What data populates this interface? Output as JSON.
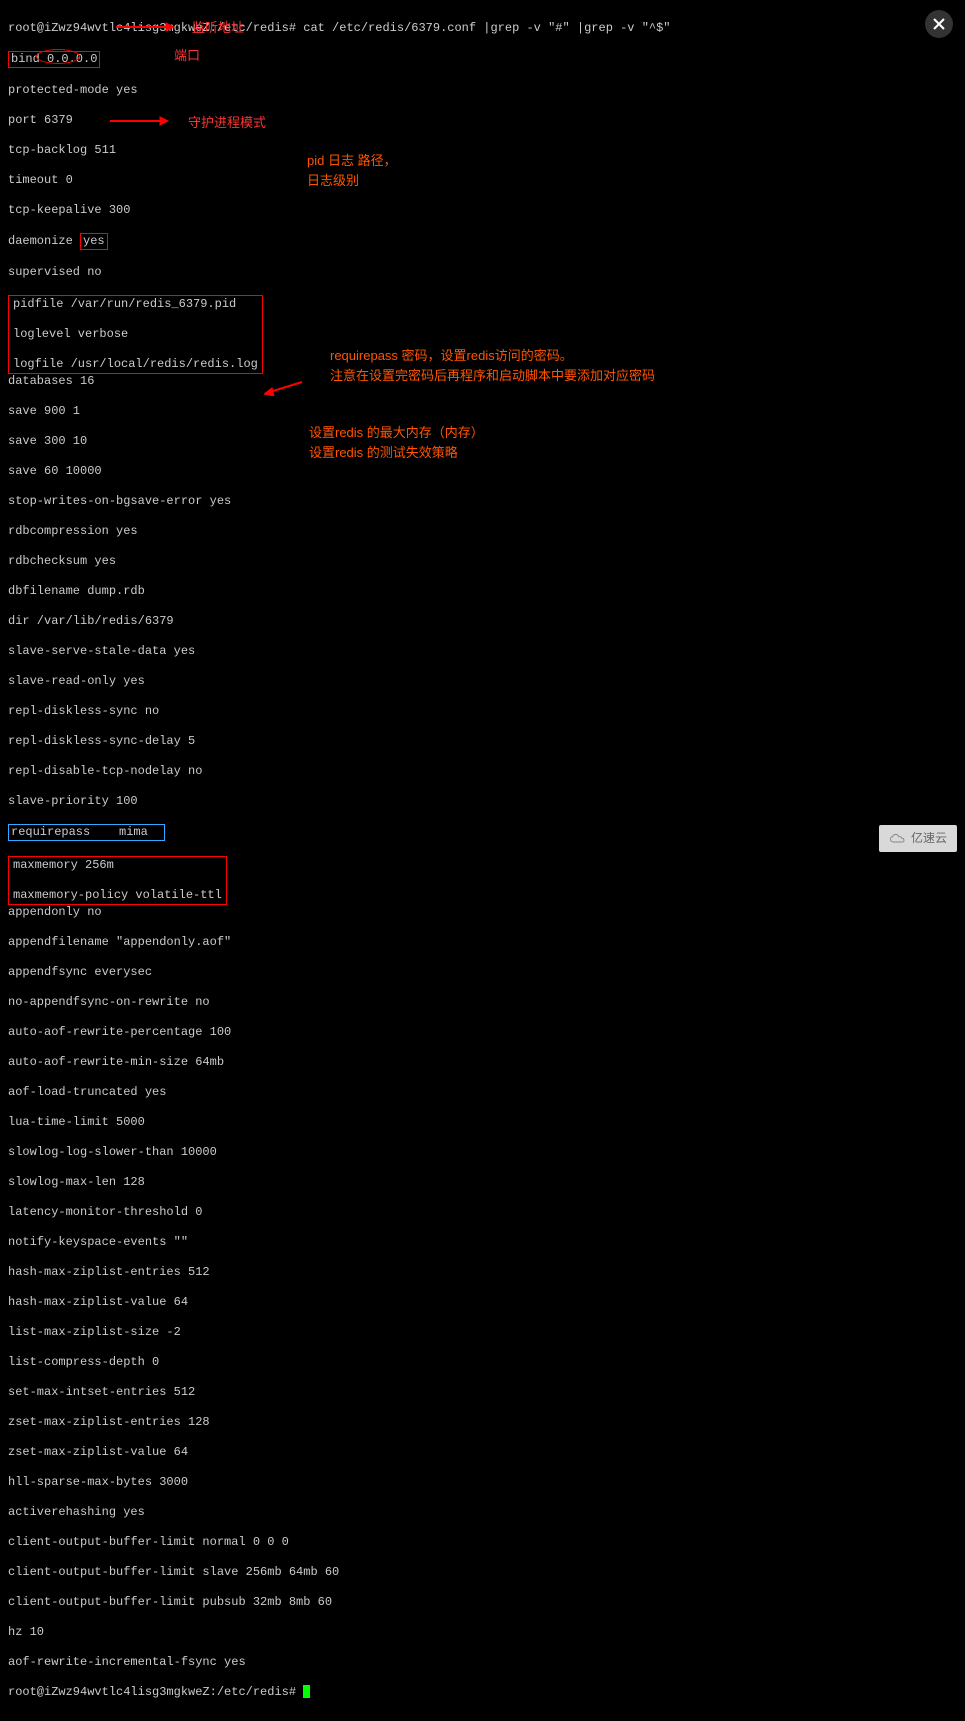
{
  "prompt_line": "root@iZwz94wvtlc4lisg3mgkweZ:/etc/redis# cat /etc/redis/6379.conf |grep -v \"#\" |grep -v \"^$\"",
  "prompt_end": "root@iZwz94wvtlc4lisg3mgkweZ:/etc/redis# ",
  "config": {
    "bind": "bind 0.0.0.0",
    "protected_mode": "protected-mode yes",
    "port": "port 6379",
    "tcp_backlog": "tcp-backlog 511",
    "timeout": "timeout 0",
    "tcp_keepalive": "tcp-keepalive 300",
    "daemonize_pre": "daemonize ",
    "daemonize_val": "yes",
    "supervised": "supervised no",
    "pidfile": "pidfile /var/run/redis_6379.pid",
    "loglevel": "loglevel verbose",
    "logfile": "logfile /usr/local/redis/redis.log",
    "databases": "databases 16",
    "save1": "save 900 1",
    "save2": "save 300 10",
    "save3": "save 60 10000",
    "stop_writes": "stop-writes-on-bgsave-error yes",
    "rdbcompression": "rdbcompression yes",
    "rdbchecksum": "rdbchecksum yes",
    "dbfilename": "dbfilename dump.rdb",
    "dir": "dir /var/lib/redis/6379",
    "slave_serve": "slave-serve-stale-data yes",
    "slave_readonly": "slave-read-only yes",
    "repl_diskless_sync": "repl-diskless-sync no",
    "repl_diskless_delay": "repl-diskless-sync-delay 5",
    "repl_disable_tcp": "repl-disable-tcp-nodelay no",
    "slave_priority": "slave-priority 100",
    "requirepass": "requirepass    mima  ",
    "maxmemory": "maxmemory 256m",
    "maxmemory_policy": "maxmemory-policy volatile-ttl",
    "appendonly": "appendonly no",
    "appendfilename": "appendfilename \"appendonly.aof\"",
    "appendfsync": "appendfsync everysec",
    "no_appendfsync": "no-appendfsync-on-rewrite no",
    "auto_aof_pct": "auto-aof-rewrite-percentage 100",
    "auto_aof_min": "auto-aof-rewrite-min-size 64mb",
    "aof_truncated": "aof-load-truncated yes",
    "lua_time": "lua-time-limit 5000",
    "slowlog_slower": "slowlog-log-slower-than 10000",
    "slowlog_maxlen": "slowlog-max-len 128",
    "latency": "latency-monitor-threshold 0",
    "notify": "notify-keyspace-events \"\"",
    "hash_entries": "hash-max-ziplist-entries 512",
    "hash_value": "hash-max-ziplist-value 64",
    "list_size": "list-max-ziplist-size -2",
    "list_compress": "list-compress-depth 0",
    "set_intset": "set-max-intset-entries 512",
    "zset_entries": "zset-max-ziplist-entries 128",
    "zset_value": "zset-max-ziplist-value 64",
    "hll_sparse": "hll-sparse-max-bytes 3000",
    "activerehashing": "activerehashing yes",
    "client_normal": "client-output-buffer-limit normal 0 0 0",
    "client_slave": "client-output-buffer-limit slave 256mb 64mb 60",
    "client_pubsub": "client-output-buffer-limit pubsub 32mb 8mb 60",
    "hz": "hz 10",
    "aof_rewrite": "aof-rewrite-incremental-fsync yes"
  },
  "annotations": {
    "bind": "监听地址",
    "port": "端口",
    "daemonize": "守护进程模式",
    "pid1": "pid 日志 路径，",
    "pid2": "日志级别",
    "requirepass1": "requirepass 密码，设置redis访问的密码。",
    "requirepass2": "注意在设置完密码后再程序和启动脚本中要添加对应密码",
    "maxmem1": "设置redis 的最大内存（内存）",
    "maxmem2": "设置redis 的测试失效策略"
  },
  "watermark": "亿速云"
}
